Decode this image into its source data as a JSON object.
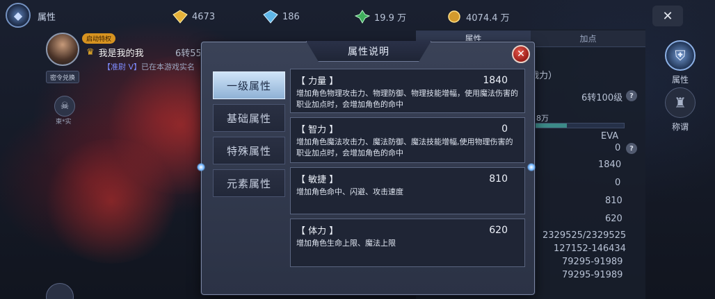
{
  "header": {
    "title": "属性",
    "resources": [
      {
        "name": "yellow-diamond-icon",
        "value": "4673"
      },
      {
        "name": "blue-diamond-icon",
        "value": "186"
      },
      {
        "name": "green-gem-icon",
        "value": "19.9 万"
      },
      {
        "name": "gold-coin-icon",
        "value": "4074.4 万"
      }
    ],
    "close_label": "✕"
  },
  "player": {
    "vip_tag": "启动特权",
    "name": "我是我的我",
    "level_partial": "6转55",
    "notice_tag": "【准尉 V】",
    "notice_text": "已在本游戏实名",
    "redeem_label": "密令兑换",
    "side_icon_label": "東*实"
  },
  "right_panel": {
    "tabs": [
      {
        "label": "属性"
      },
      {
        "label": "加点"
      }
    ],
    "power_suffix": "战力）",
    "level_text": "6转100级",
    "exp_text": "38万",
    "eva_label": "EVA",
    "values": [
      "0",
      "1840",
      "0",
      "810",
      "620",
      "2329525/2329525",
      "127152-146434",
      "79295-91989",
      "79295-91989"
    ]
  },
  "right_nav": [
    {
      "label": "属性",
      "icon": "helmet-icon",
      "active": true
    },
    {
      "label": "称谓",
      "icon": "title-icon",
      "active": false
    }
  ],
  "modal": {
    "title": "属性说明",
    "close_label": "✕",
    "tabs": [
      {
        "label": "一级属性",
        "active": true
      },
      {
        "label": "基础属性",
        "active": false
      },
      {
        "label": "特殊属性",
        "active": false
      },
      {
        "label": "元素属性",
        "active": false
      }
    ],
    "attributes": [
      {
        "name": "【 力量 】",
        "value": "1840",
        "desc": "增加角色物理攻击力、物理防御、物理技能增幅，使用魔法伤害的职业加点时，会增加角色的命中"
      },
      {
        "name": "【 智力 】",
        "value": "0",
        "desc": "增加角色魔法攻击力、魔法防御、魔法技能增幅,使用物理伤害的职业加点时，会增加角色的命中"
      },
      {
        "name": "【 敏捷 】",
        "value": "810",
        "desc": "增加角色命中、闪避、攻击速度"
      },
      {
        "name": "【 体力 】",
        "value": "620",
        "desc": "增加角色生命上限、魔法上限"
      }
    ]
  },
  "colors": {
    "accent_blue": "#8fb1d5",
    "close_red": "#c0392b",
    "panel_bg": "#1f2535"
  }
}
